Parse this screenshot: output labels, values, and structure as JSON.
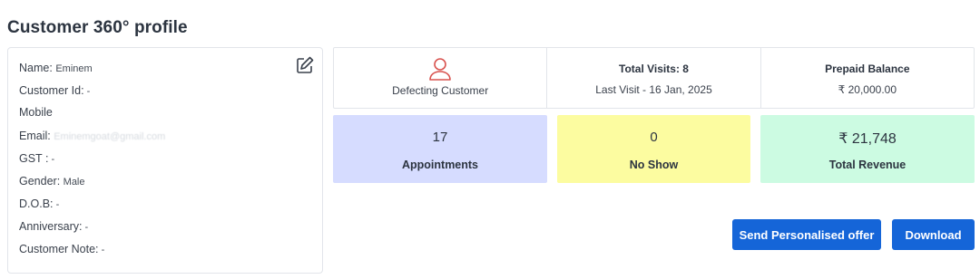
{
  "page": {
    "title": "Customer 360° profile"
  },
  "profile": {
    "name_label": "Name:",
    "name_value": "Eminem",
    "id_label": "Customer Id:",
    "id_value": " -",
    "mobile_label": "Mobile",
    "mobile_value": "",
    "email_label": "Email:",
    "email_value": "Eminemgoat@gmail.com",
    "gst_label": "GST :",
    "gst_value": " -",
    "gender_label": "Gender:",
    "gender_value": "Male",
    "dob_label": "D.O.B:",
    "dob_value": " -",
    "anniversary_label": "Anniversary:",
    "anniversary_value": " -",
    "note_label": "Customer Note:",
    "note_value": " -"
  },
  "stats": {
    "segment_label": "Defecting Customer",
    "visits_title": "Total Visits: 8",
    "last_visit": "Last Visit - 16 Jan, 2025",
    "prepaid_title": "Prepaid Balance",
    "prepaid_value": "₹ 20,000.00"
  },
  "metrics": {
    "appointments": {
      "value": "17",
      "label": "Appointments"
    },
    "no_show": {
      "value": "0",
      "label": "No Show"
    },
    "revenue": {
      "value": "₹ 21,748",
      "label": "Total Revenue"
    }
  },
  "actions": {
    "offer_label": "Send Personalised offer",
    "download_label": "Download"
  },
  "colors": {
    "primary": "#1565d8",
    "appointments_bg": "#d6dcff",
    "no_show_bg": "#fcfca0",
    "revenue_bg": "#ccfbe2",
    "defecting_icon": "#d9534f"
  },
  "icons": {
    "edit": "edit-icon",
    "segment": "person-icon"
  }
}
